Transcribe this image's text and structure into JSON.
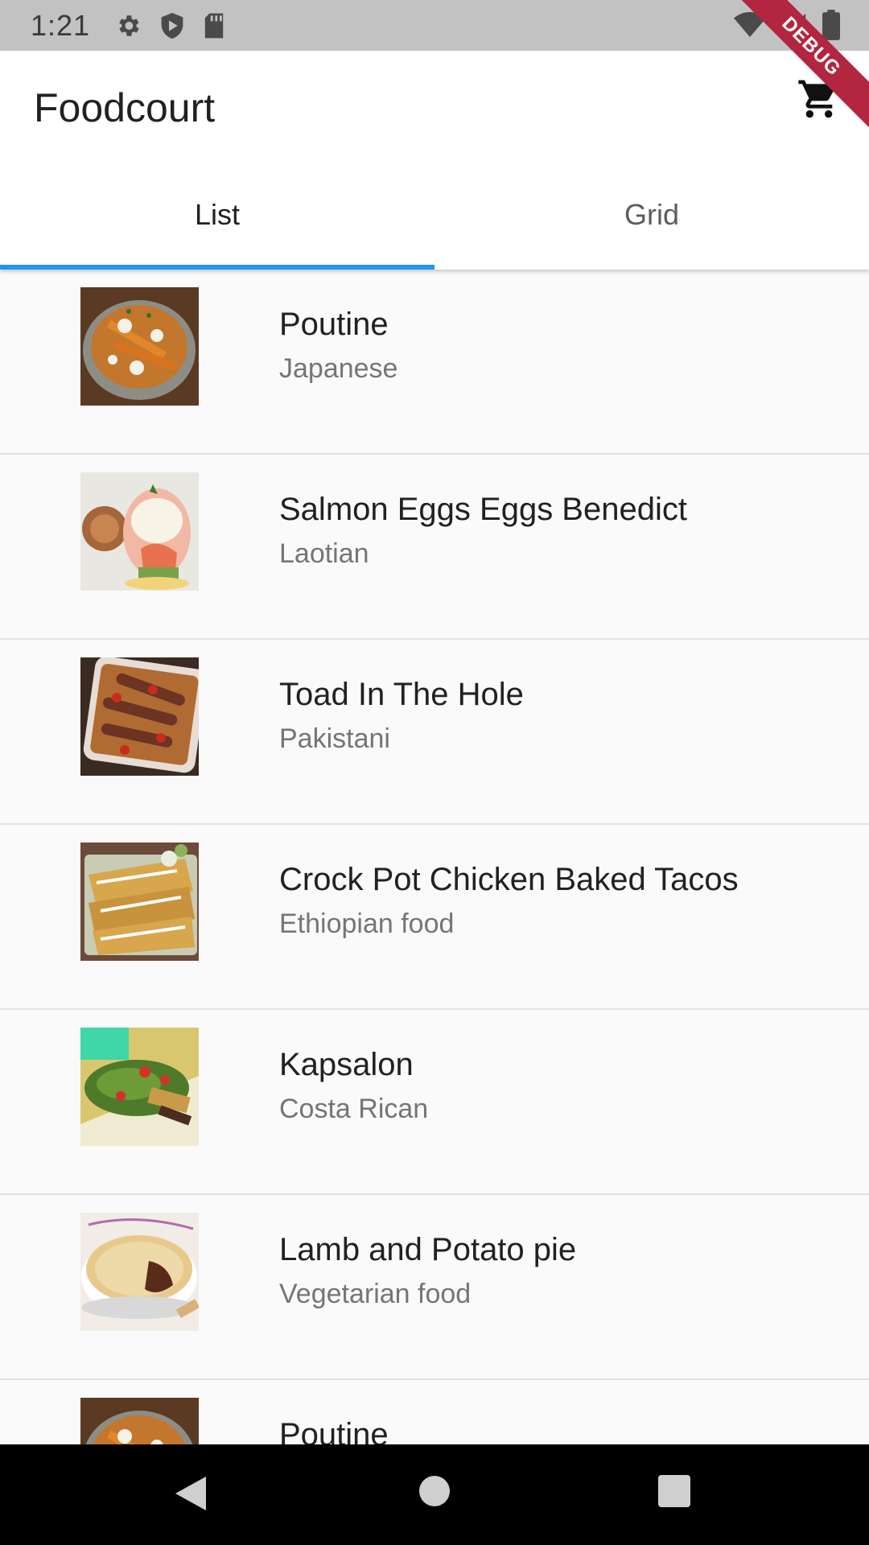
{
  "status_bar": {
    "time": "1:21",
    "left_icons": [
      "settings-icon",
      "shield-icon",
      "sd-card-icon"
    ],
    "right_icons": [
      "wifi-icon",
      "signal-icon",
      "battery-icon"
    ]
  },
  "app_bar": {
    "title": "Foodcourt",
    "cart_icon": "cart-icon",
    "debug_banner": "DEBUG"
  },
  "tabs": [
    {
      "label": "List",
      "active": true
    },
    {
      "label": "Grid",
      "active": false
    }
  ],
  "accent_color": "#2196f3",
  "items": [
    {
      "title": "Poutine",
      "subtitle": "Japanese"
    },
    {
      "title": "Salmon Eggs Eggs Benedict",
      "subtitle": "Laotian"
    },
    {
      "title": "Toad In The Hole",
      "subtitle": "Pakistani"
    },
    {
      "title": "Crock Pot Chicken Baked Tacos",
      "subtitle": "Ethiopian food"
    },
    {
      "title": "Kapsalon",
      "subtitle": "Costa Rican"
    },
    {
      "title": "Lamb and Potato pie",
      "subtitle": "Vegetarian food"
    },
    {
      "title": "Poutine",
      "subtitle": ""
    }
  ],
  "nav_bar": {
    "icons": [
      "back-icon",
      "home-icon",
      "recent-apps-icon"
    ]
  }
}
